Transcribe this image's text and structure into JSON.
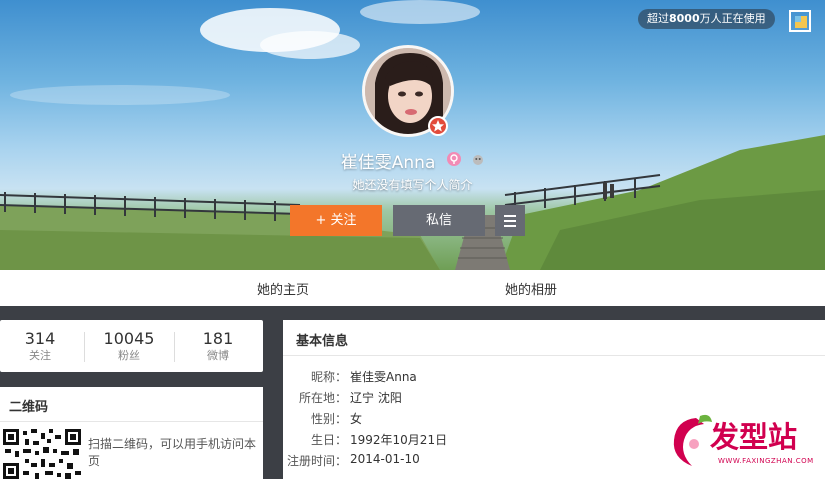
{
  "badge": {
    "prefix": "超过",
    "count": "8000",
    "suffix": "万人正在使用"
  },
  "profile": {
    "name": "崔佳雯Anna",
    "bio": "她还没有填写个人简介"
  },
  "actions": {
    "follow": "+ 关注",
    "message": "私信"
  },
  "nav": {
    "home": "她的主页",
    "album": "她的相册"
  },
  "stats": [
    {
      "value": "314",
      "label": "关注"
    },
    {
      "value": "10045",
      "label": "粉丝"
    },
    {
      "value": "181",
      "label": "微博"
    }
  ],
  "qr": {
    "title": "二维码",
    "text": "扫描二维码，可以用手机访问本页"
  },
  "info": {
    "title": "基本信息",
    "rows": [
      {
        "key": "昵称：",
        "value": "崔佳雯Anna"
      },
      {
        "key": "所在地：",
        "value": "辽宁 沈阳"
      },
      {
        "key": "性别：",
        "value": "女"
      },
      {
        "key": "生日：",
        "value": "1992年10月21日"
      },
      {
        "key": "注册时间：",
        "value": "2014-01-10"
      }
    ]
  },
  "watermark": {
    "brand": "发型站",
    "url": "WWW.FAXINGZHAN.COM"
  },
  "colors": {
    "follow": "#f3762a",
    "secondary": "#666a73",
    "brand": "#d1004f"
  }
}
